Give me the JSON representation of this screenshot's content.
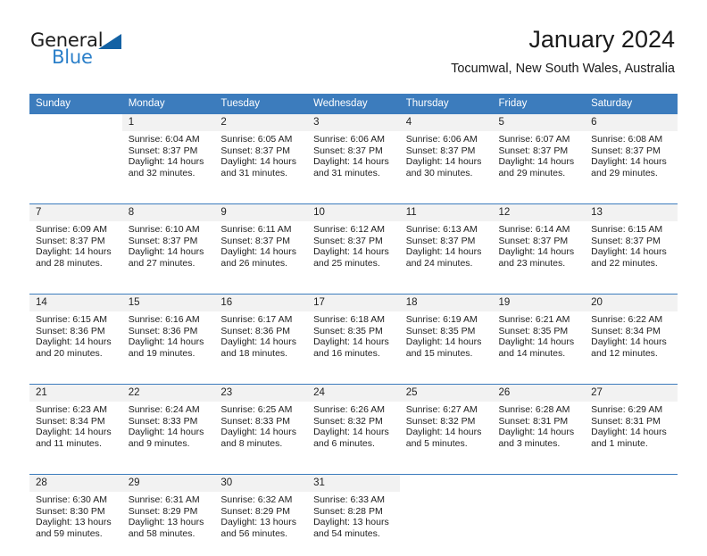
{
  "brand": {
    "name_part1": "General",
    "name_part2": "Blue",
    "triangle_color": "#1362a4",
    "blue_color": "#2a7fc9"
  },
  "header": {
    "title": "January 2024",
    "subtitle": "Tocumwal, New South Wales, Australia"
  },
  "theme": {
    "header_row_bg": "#3c7cbd",
    "daynum_bg": "#f2f2f2",
    "separator": "#3c7cbd",
    "text": "#222222"
  },
  "columns": [
    {
      "label": "Sunday"
    },
    {
      "label": "Monday"
    },
    {
      "label": "Tuesday"
    },
    {
      "label": "Wednesday"
    },
    {
      "label": "Thursday"
    },
    {
      "label": "Friday"
    },
    {
      "label": "Saturday"
    }
  ],
  "weeks": [
    {
      "days": [
        {
          "num": "",
          "sunrise": "",
          "sunset": "",
          "daylight1": "",
          "daylight2": ""
        },
        {
          "num": "1",
          "sunrise": "Sunrise: 6:04 AM",
          "sunset": "Sunset: 8:37 PM",
          "daylight1": "Daylight: 14 hours",
          "daylight2": "and 32 minutes."
        },
        {
          "num": "2",
          "sunrise": "Sunrise: 6:05 AM",
          "sunset": "Sunset: 8:37 PM",
          "daylight1": "Daylight: 14 hours",
          "daylight2": "and 31 minutes."
        },
        {
          "num": "3",
          "sunrise": "Sunrise: 6:06 AM",
          "sunset": "Sunset: 8:37 PM",
          "daylight1": "Daylight: 14 hours",
          "daylight2": "and 31 minutes."
        },
        {
          "num": "4",
          "sunrise": "Sunrise: 6:06 AM",
          "sunset": "Sunset: 8:37 PM",
          "daylight1": "Daylight: 14 hours",
          "daylight2": "and 30 minutes."
        },
        {
          "num": "5",
          "sunrise": "Sunrise: 6:07 AM",
          "sunset": "Sunset: 8:37 PM",
          "daylight1": "Daylight: 14 hours",
          "daylight2": "and 29 minutes."
        },
        {
          "num": "6",
          "sunrise": "Sunrise: 6:08 AM",
          "sunset": "Sunset: 8:37 PM",
          "daylight1": "Daylight: 14 hours",
          "daylight2": "and 29 minutes."
        }
      ]
    },
    {
      "days": [
        {
          "num": "7",
          "sunrise": "Sunrise: 6:09 AM",
          "sunset": "Sunset: 8:37 PM",
          "daylight1": "Daylight: 14 hours",
          "daylight2": "and 28 minutes."
        },
        {
          "num": "8",
          "sunrise": "Sunrise: 6:10 AM",
          "sunset": "Sunset: 8:37 PM",
          "daylight1": "Daylight: 14 hours",
          "daylight2": "and 27 minutes."
        },
        {
          "num": "9",
          "sunrise": "Sunrise: 6:11 AM",
          "sunset": "Sunset: 8:37 PM",
          "daylight1": "Daylight: 14 hours",
          "daylight2": "and 26 minutes."
        },
        {
          "num": "10",
          "sunrise": "Sunrise: 6:12 AM",
          "sunset": "Sunset: 8:37 PM",
          "daylight1": "Daylight: 14 hours",
          "daylight2": "and 25 minutes."
        },
        {
          "num": "11",
          "sunrise": "Sunrise: 6:13 AM",
          "sunset": "Sunset: 8:37 PM",
          "daylight1": "Daylight: 14 hours",
          "daylight2": "and 24 minutes."
        },
        {
          "num": "12",
          "sunrise": "Sunrise: 6:14 AM",
          "sunset": "Sunset: 8:37 PM",
          "daylight1": "Daylight: 14 hours",
          "daylight2": "and 23 minutes."
        },
        {
          "num": "13",
          "sunrise": "Sunrise: 6:15 AM",
          "sunset": "Sunset: 8:37 PM",
          "daylight1": "Daylight: 14 hours",
          "daylight2": "and 22 minutes."
        }
      ]
    },
    {
      "days": [
        {
          "num": "14",
          "sunrise": "Sunrise: 6:15 AM",
          "sunset": "Sunset: 8:36 PM",
          "daylight1": "Daylight: 14 hours",
          "daylight2": "and 20 minutes."
        },
        {
          "num": "15",
          "sunrise": "Sunrise: 6:16 AM",
          "sunset": "Sunset: 8:36 PM",
          "daylight1": "Daylight: 14 hours",
          "daylight2": "and 19 minutes."
        },
        {
          "num": "16",
          "sunrise": "Sunrise: 6:17 AM",
          "sunset": "Sunset: 8:36 PM",
          "daylight1": "Daylight: 14 hours",
          "daylight2": "and 18 minutes."
        },
        {
          "num": "17",
          "sunrise": "Sunrise: 6:18 AM",
          "sunset": "Sunset: 8:35 PM",
          "daylight1": "Daylight: 14 hours",
          "daylight2": "and 16 minutes."
        },
        {
          "num": "18",
          "sunrise": "Sunrise: 6:19 AM",
          "sunset": "Sunset: 8:35 PM",
          "daylight1": "Daylight: 14 hours",
          "daylight2": "and 15 minutes."
        },
        {
          "num": "19",
          "sunrise": "Sunrise: 6:21 AM",
          "sunset": "Sunset: 8:35 PM",
          "daylight1": "Daylight: 14 hours",
          "daylight2": "and 14 minutes."
        },
        {
          "num": "20",
          "sunrise": "Sunrise: 6:22 AM",
          "sunset": "Sunset: 8:34 PM",
          "daylight1": "Daylight: 14 hours",
          "daylight2": "and 12 minutes."
        }
      ]
    },
    {
      "days": [
        {
          "num": "21",
          "sunrise": "Sunrise: 6:23 AM",
          "sunset": "Sunset: 8:34 PM",
          "daylight1": "Daylight: 14 hours",
          "daylight2": "and 11 minutes."
        },
        {
          "num": "22",
          "sunrise": "Sunrise: 6:24 AM",
          "sunset": "Sunset: 8:33 PM",
          "daylight1": "Daylight: 14 hours",
          "daylight2": "and 9 minutes."
        },
        {
          "num": "23",
          "sunrise": "Sunrise: 6:25 AM",
          "sunset": "Sunset: 8:33 PM",
          "daylight1": "Daylight: 14 hours",
          "daylight2": "and 8 minutes."
        },
        {
          "num": "24",
          "sunrise": "Sunrise: 6:26 AM",
          "sunset": "Sunset: 8:32 PM",
          "daylight1": "Daylight: 14 hours",
          "daylight2": "and 6 minutes."
        },
        {
          "num": "25",
          "sunrise": "Sunrise: 6:27 AM",
          "sunset": "Sunset: 8:32 PM",
          "daylight1": "Daylight: 14 hours",
          "daylight2": "and 5 minutes."
        },
        {
          "num": "26",
          "sunrise": "Sunrise: 6:28 AM",
          "sunset": "Sunset: 8:31 PM",
          "daylight1": "Daylight: 14 hours",
          "daylight2": "and 3 minutes."
        },
        {
          "num": "27",
          "sunrise": "Sunrise: 6:29 AM",
          "sunset": "Sunset: 8:31 PM",
          "daylight1": "Daylight: 14 hours",
          "daylight2": "and 1 minute."
        }
      ]
    },
    {
      "days": [
        {
          "num": "28",
          "sunrise": "Sunrise: 6:30 AM",
          "sunset": "Sunset: 8:30 PM",
          "daylight1": "Daylight: 13 hours",
          "daylight2": "and 59 minutes."
        },
        {
          "num": "29",
          "sunrise": "Sunrise: 6:31 AM",
          "sunset": "Sunset: 8:29 PM",
          "daylight1": "Daylight: 13 hours",
          "daylight2": "and 58 minutes."
        },
        {
          "num": "30",
          "sunrise": "Sunrise: 6:32 AM",
          "sunset": "Sunset: 8:29 PM",
          "daylight1": "Daylight: 13 hours",
          "daylight2": "and 56 minutes."
        },
        {
          "num": "31",
          "sunrise": "Sunrise: 6:33 AM",
          "sunset": "Sunset: 8:28 PM",
          "daylight1": "Daylight: 13 hours",
          "daylight2": "and 54 minutes."
        },
        {
          "num": "",
          "sunrise": "",
          "sunset": "",
          "daylight1": "",
          "daylight2": ""
        },
        {
          "num": "",
          "sunrise": "",
          "sunset": "",
          "daylight1": "",
          "daylight2": ""
        },
        {
          "num": "",
          "sunrise": "",
          "sunset": "",
          "daylight1": "",
          "daylight2": ""
        }
      ]
    }
  ]
}
